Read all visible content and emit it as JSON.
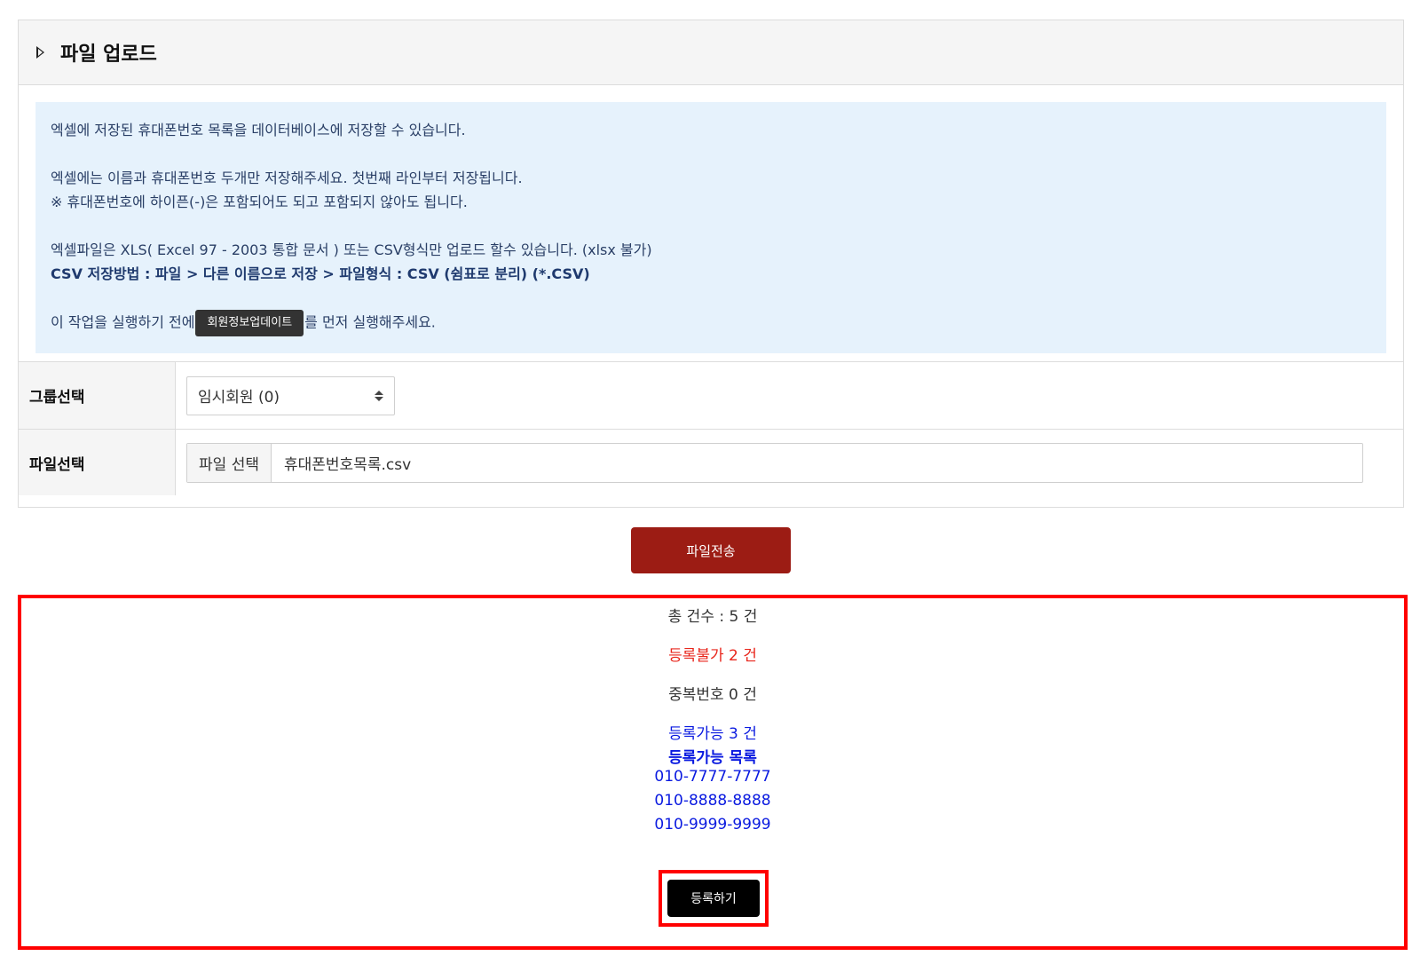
{
  "panel": {
    "title": "파일 업로드"
  },
  "info": {
    "line1": "엑셀에 저장된 휴대폰번호 목록을 데이터베이스에 저장할 수 있습니다.",
    "line2": "엑셀에는 이름과 휴대폰번호 두개만 저장해주세요. 첫번째 라인부터 저장됩니다.",
    "line3": "※ 휴대폰번호에 하이픈(-)은 포함되어도 되고 포함되지 않아도 됩니다.",
    "line4": "엑셀파일은 XLS( Excel 97 - 2003 통합 문서 ) 또는 CSV형식만 업로드 할수 있습니다. (xlsx 불가)",
    "line5": "CSV 저장방법 : 파일 > 다른 이름으로 저장 > 파일형식 : CSV (쉼표로 분리) (*.CSV)",
    "line6_prefix": "이 작업을 실행하기 전에",
    "line6_button": "회원정보업데이트",
    "line6_suffix": "를 먼저 실행해주세요."
  },
  "form": {
    "group_label": "그룹선택",
    "group_selected": "임시회원 (0)",
    "file_label": "파일선택",
    "file_button": "파일 선택",
    "file_name": "휴대폰번호목록.csv"
  },
  "send_button": "파일전송",
  "result": {
    "total": "총 건수 : 5 건",
    "rejected": "등록불가 2 건",
    "duplicate": "중복번호 0 건",
    "available": "등록가능 3 건",
    "available_list_title": "등록가능 목록",
    "phones": [
      "010-7777-7777",
      "010-8888-8888",
      "010-9999-9999"
    ],
    "register_button": "등록하기"
  },
  "colors": {
    "header_bg": "#f5f5f5",
    "info_bg": "#e6f2fc",
    "send_button": "#9c1c14",
    "highlight_border": "#ff0000",
    "rejected_text": "#e8261c",
    "available_text": "#0a1ae0"
  }
}
